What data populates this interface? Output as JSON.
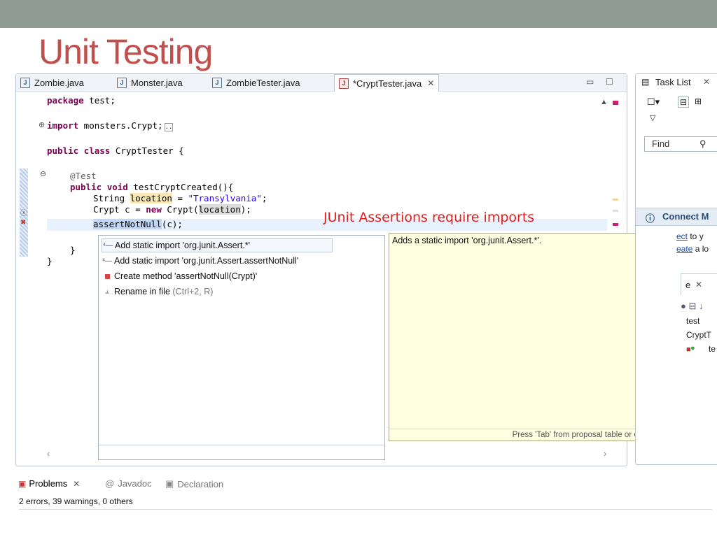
{
  "slide": {
    "title": "Unit Testing"
  },
  "editor": {
    "tabs": [
      {
        "label": "Zombie.java"
      },
      {
        "label": "Monster.java"
      },
      {
        "label": "ZombieTester.java"
      },
      {
        "label": "*CryptTester.java",
        "active": true
      }
    ],
    "code": {
      "l1_kw": "package",
      "l1_rest": " test;",
      "l2_kw": "import",
      "l2_rest": " monsters.Crypt;",
      "l3_kw1": "public",
      "l3_kw2": "class",
      "l3_rest": " CryptTester {",
      "l4_ann": "@Test",
      "l5_kw1": "public",
      "l5_kw2": "void",
      "l5_rest": " testCryptCreated(){",
      "l6_a": "String ",
      "l6_var": "location",
      "l6_b": " = ",
      "l6_str": "\"Transylvania\"",
      "l6_c": ";",
      "l7_a": "Crypt c = ",
      "l7_kw": "new",
      "l7_b": " Crypt(",
      "l7_var": "location",
      "l7_c": ");",
      "l8_sel": "assertNotNull",
      "l8_rest": "(c);",
      "l9": "}",
      "l10": "}"
    }
  },
  "annotation": "JUnit Assertions require imports",
  "proposals": [
    {
      "label": "Add static import 'org.junit.Assert.*'",
      "selected": true
    },
    {
      "label": "Add static import 'org.junit.Assert.assertNotNull'"
    },
    {
      "label": "Create method 'assertNotNull(Crypt)'"
    },
    {
      "label": "Rename in file",
      "shortcut": "(Ctrl+2, R)"
    }
  ],
  "doc": {
    "text": "Adds a static import 'org.junit.Assert.*'.",
    "footer": "Press 'Tab' from proposal table or click for focus"
  },
  "right_pane": {
    "task_list": "Task List",
    "find": "Find",
    "connect": "Connect M",
    "connect_line1_link": "ect",
    "connect_line1_rest": " to y",
    "connect_line2_link": "eate",
    "connect_line2_rest": " a lo",
    "outline_tab": "e",
    "outline_item1": "test",
    "outline_item2": "CryptT",
    "outline_item3": "te"
  },
  "bottom": {
    "tabs": [
      {
        "label": "Problems",
        "active": true
      },
      {
        "label": "Javadoc"
      },
      {
        "label": "Declaration"
      }
    ],
    "status": "2 errors, 39 warnings, 0 others"
  },
  "colors": {
    "title": "#c0504d",
    "annotation": "#e0201c",
    "topbar": "#8e9a94"
  }
}
